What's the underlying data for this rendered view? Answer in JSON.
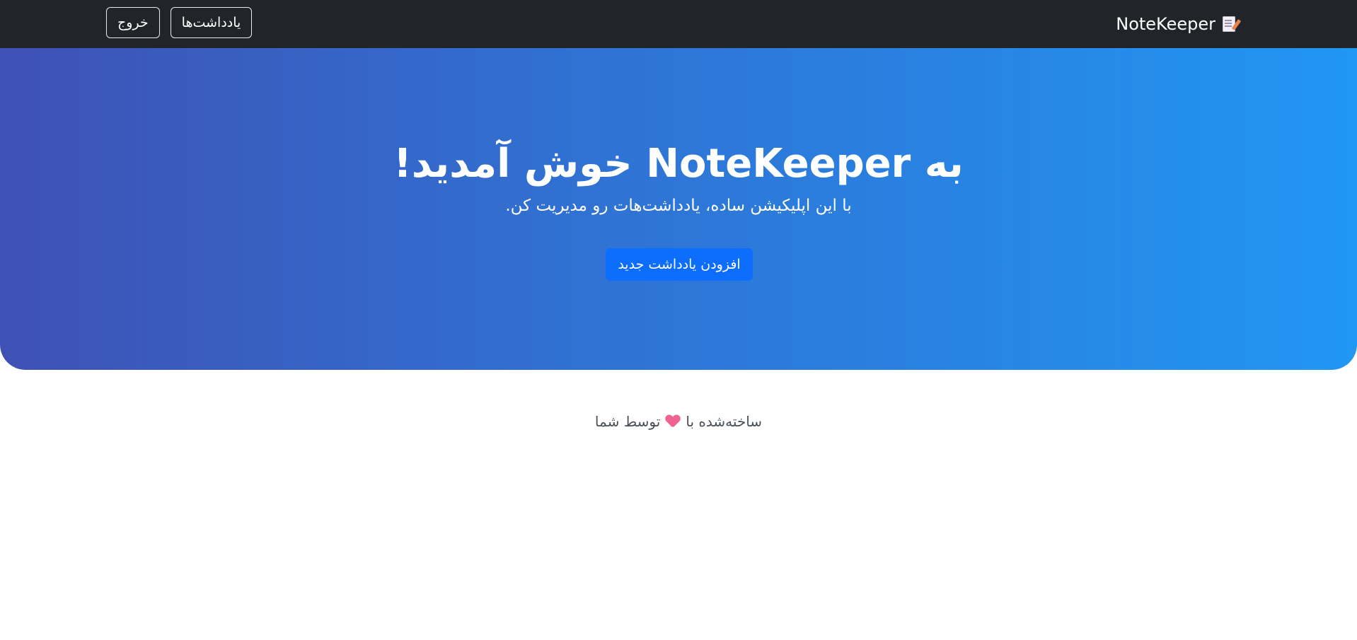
{
  "navbar": {
    "brand": "NoteKeeper",
    "brand_icon": "memo-icon",
    "notes_label": "یادداشت‌ها",
    "logout_label": "خروج",
    "background": "#212529"
  },
  "hero": {
    "title": "به NoteKeeper خوش آمدید!",
    "subtitle": "با این اپلیکیشن ساده، یادداشت‌هات رو مدیریت کن.",
    "add_note_label": "افزودن یادداشت جدید",
    "gradient_start": "#3f51b5",
    "gradient_end": "#2196f3",
    "button_color": "#0d6efd"
  },
  "footer": {
    "before_heart": "ساخته‌شده با",
    "heart_icon": "heart-icon",
    "after_heart": "توسط شما"
  }
}
